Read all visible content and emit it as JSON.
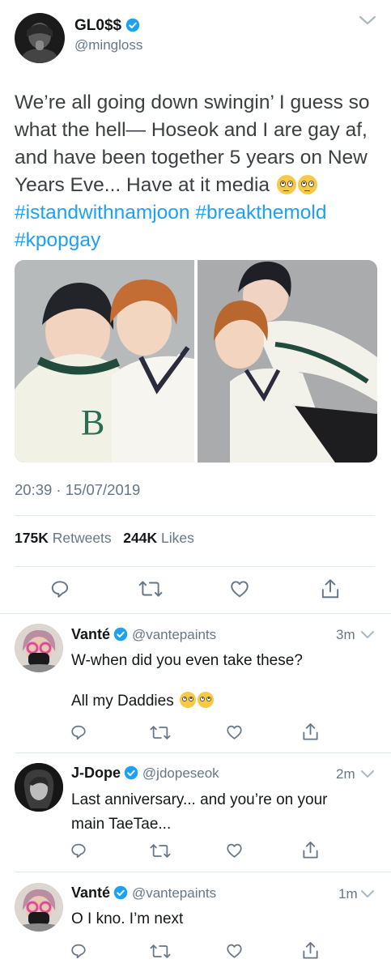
{
  "main_tweet": {
    "display_name": "GL0$$",
    "handle": "@mingloss",
    "text_part1": "We’re all going down swingin’ I guess so what the hell— Hoseok and I are gay af, and have been together 5 years on New Years Eve... Have at it media",
    "hashtag1": "#istandwithnamjoon",
    "hashtag2": "#breakthemold",
    "hashtag3": "#kpopgay",
    "timestamp": "20:39 · 15/07/2019",
    "retweet_count": "175K",
    "retweet_label": "Retweets",
    "like_count": "244K",
    "like_label": "Likes"
  },
  "replies": [
    {
      "display_name": "Vanté",
      "handle": "@vantepaints",
      "time": "3m",
      "line1": "W-when did you even take these?",
      "line2": "All my Daddies"
    },
    {
      "display_name": "J-Dope",
      "handle": "@jdopeseok",
      "time": "2m",
      "line1": "Last anniversary... and you’re on your",
      "line2": "main TaeTae..."
    },
    {
      "display_name": "Vanté",
      "handle": "@vantepaints",
      "time": "1m",
      "line1": "O I kno. I’m next"
    }
  ],
  "colors": {
    "accent": "#1da1f2",
    "text": "#14171a",
    "secondary": "#657786",
    "divider": "#e1e8ed"
  },
  "icons": [
    "reply-icon",
    "retweet-icon",
    "like-icon",
    "share-icon",
    "verified-icon",
    "chevron-down-icon"
  ]
}
